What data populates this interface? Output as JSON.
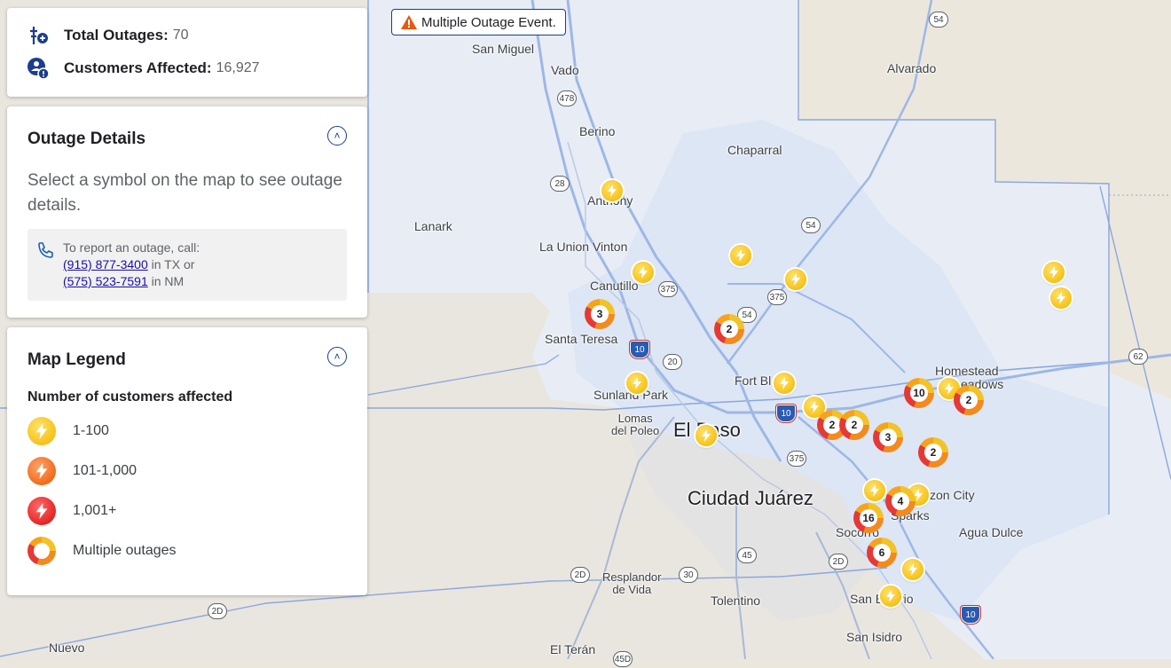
{
  "stats": {
    "total_outages_label": "Total Outages:",
    "total_outages_value": "70",
    "customers_affected_label": "Customers Affected:",
    "customers_affected_value": "16,927"
  },
  "event_banner": {
    "label": "Multiple Outage Event."
  },
  "details": {
    "title": "Outage Details",
    "hint": "Select a symbol on the map to see outage details.",
    "report_intro": "To report an outage, call:",
    "phone_tx": "(915) 877-3400",
    "phone_tx_suffix": " in TX or",
    "phone_nm": "(575) 523-7591",
    "phone_nm_suffix": " in NM"
  },
  "legend": {
    "title": "Map Legend",
    "subtitle": "Number of customers affected",
    "items": [
      {
        "label": "1-100",
        "color": "#f6c21a"
      },
      {
        "label": "101-1,000",
        "color": "#f26b1d"
      },
      {
        "label": "1,001+",
        "color": "#e42626"
      },
      {
        "label": "Multiple outages",
        "color": "#f8a21c"
      }
    ]
  },
  "icons": {
    "outages": "power-line-icon",
    "customers": "customer-alert-icon",
    "phone": "phone-icon",
    "warning": "warning-icon",
    "collapse": "chevron-up-icon",
    "bolt": "lightning-bolt-icon"
  },
  "map": {
    "places": {
      "san_miguel": "San Miguel",
      "vado": "Vado",
      "alvarado": "Alvarado",
      "berino": "Berino",
      "chaparral": "Chaparral",
      "anthony": "Anthony",
      "lanark": "Lanark",
      "la_union_vinton": "La Union Vinton",
      "canutillo": "Canutillo",
      "santa_teresa": "Santa Teresa",
      "homestead": "Homestead",
      "meadows": "eadows",
      "fort_bliss": "Fort Bl",
      "sunland_park": "Sunland Park",
      "lomas_del_poleo": "Lomas\ndel Poleo",
      "el_paso": "El Paso",
      "ciudad_juarez": "Ciudad Juárez",
      "horizon_city": "zon City",
      "sparks": "Sparks",
      "agua_dulce": "Agua Dulce",
      "socorro": "Socorro",
      "resplandor": "Resplandor\nde Vida",
      "tolentino": "Tolentino",
      "san_elizario": "San E",
      "san_elizario_end": "rio",
      "san_isidro": "San Isidro",
      "el_teran": "El Terán",
      "nuevo": "Nuevo"
    },
    "shields": {
      "s478": "478",
      "s28": "28",
      "s54a": "54",
      "s54b": "54",
      "s54c": "54",
      "s375a": "375",
      "s375b": "375",
      "s375c": "375",
      "s20": "20",
      "s10a": "10",
      "s10b": "10",
      "s10c": "10",
      "s62": "62",
      "s2da": "2D",
      "s2db": "2D",
      "s2dc": "2D",
      "s30": "30",
      "s45": "45",
      "s45b": "45D"
    },
    "clusters": [
      "3",
      "2",
      "10",
      "2",
      "2",
      "2",
      "3",
      "2",
      "4",
      "16",
      "6"
    ]
  }
}
